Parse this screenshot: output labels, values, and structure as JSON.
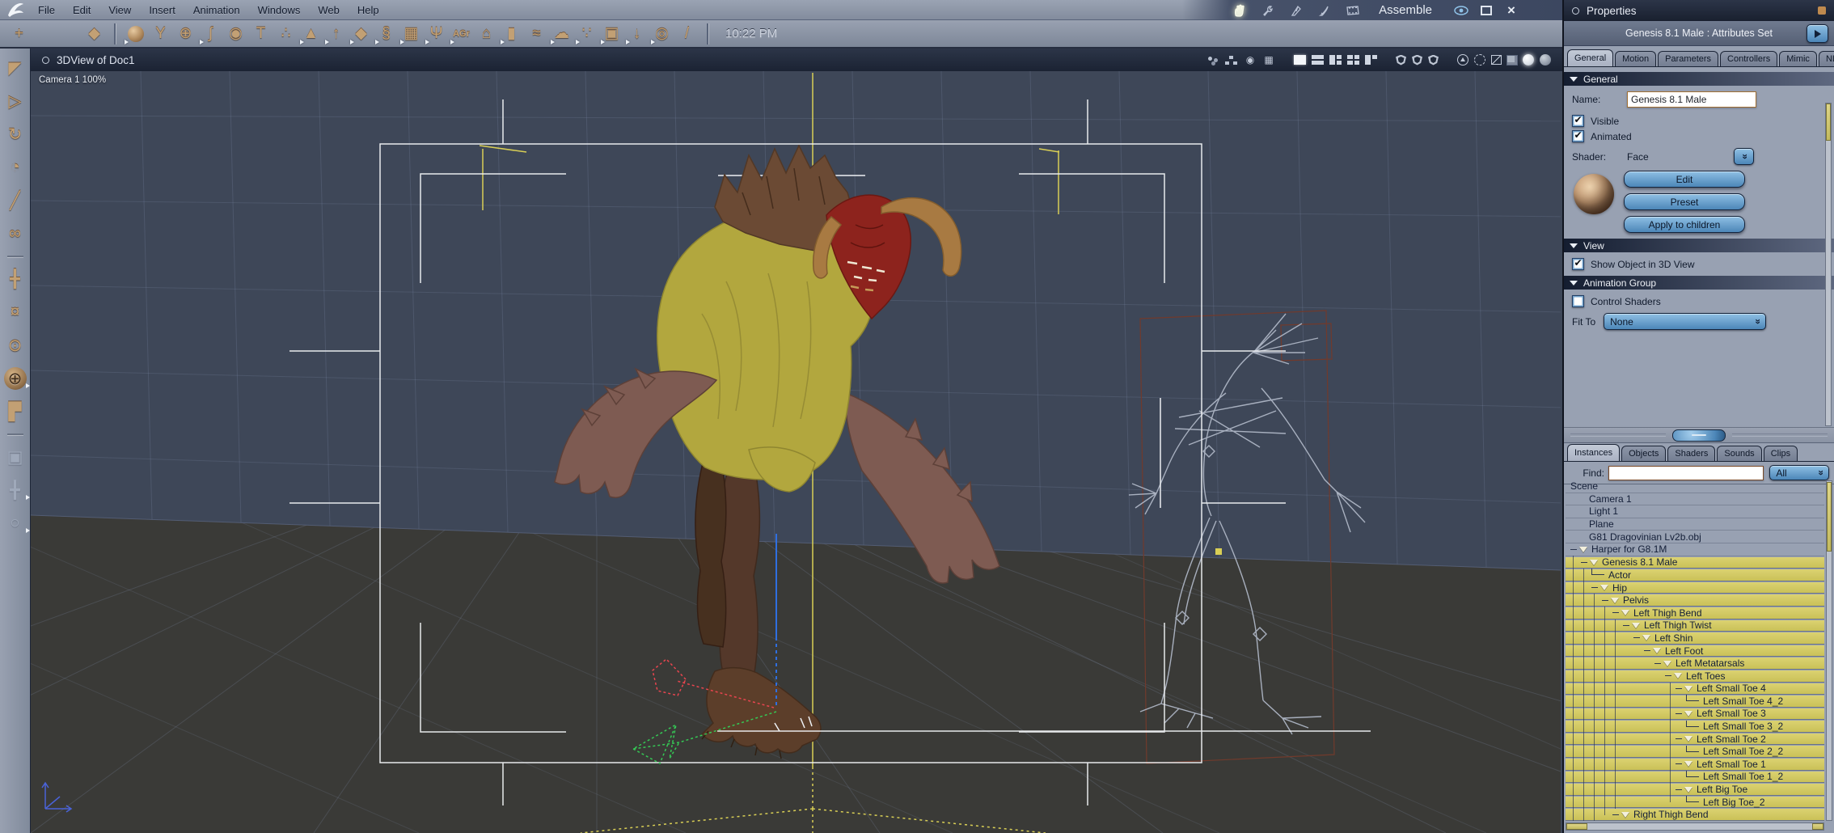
{
  "colors": {
    "accent_blue": "#4c86b8",
    "selection_yellow": "#d3ca62",
    "viewport_bg": "#3e4758",
    "floor": "#3a3a37",
    "panel_bg": "#98a1b2",
    "bar_bg": "#8e96a6",
    "titlebar": "#1b2333"
  },
  "menu": {
    "items": [
      {
        "label": "File"
      },
      {
        "label": "Edit"
      },
      {
        "label": "View"
      },
      {
        "label": "Insert"
      },
      {
        "label": "Animation"
      },
      {
        "label": "Windows"
      },
      {
        "label": "Web"
      },
      {
        "label": "Help"
      }
    ]
  },
  "rooms": {
    "current_label": "Assemble"
  },
  "window_controls": {
    "close_glyph": "×"
  },
  "toolbar": {
    "time": "10:22 PM",
    "group1": [
      {
        "icon": "bone-chain-tool-icon",
        "glyph": "+"
      },
      {
        "icon": "hand-tool-icon",
        "glyph": "",
        "dim": true
      },
      {
        "icon": "wrench-tool-icon",
        "glyph": "",
        "dim": true
      },
      {
        "icon": "stamp-tool-icon",
        "glyph": "◆"
      }
    ],
    "group2": [
      {
        "icon": "insert-sphere-icon",
        "type": "ball",
        "glyph": "",
        "marker": true
      },
      {
        "icon": "insert-vertex-object-icon",
        "glyph": "Y"
      },
      {
        "icon": "insert-metaball-icon",
        "glyph": "⊕"
      },
      {
        "icon": "insert-spline-icon",
        "glyph": "∫",
        "marker": true
      },
      {
        "icon": "insert-cone-icon",
        "glyph": "◉"
      },
      {
        "icon": "insert-text-icon",
        "glyph": "T"
      },
      {
        "icon": "insert-particles-icon",
        "glyph": "∴"
      },
      {
        "icon": "insert-terrain-icon",
        "glyph": "▲",
        "marker": true
      },
      {
        "icon": "insert-tree-icon",
        "glyph": "↑",
        "marker": true
      },
      {
        "icon": "insert-rock-icon",
        "glyph": "◆",
        "marker": true
      },
      {
        "icon": "insert-fire-icon",
        "glyph": "§",
        "marker": true
      },
      {
        "icon": "insert-terrain-checker-icon",
        "glyph": "▦",
        "marker": true
      },
      {
        "icon": "insert-fountain-icon",
        "glyph": "Ψ",
        "marker": true
      },
      {
        "icon": "insert-autogroup-icon",
        "type": "label",
        "glyph": "AGr",
        "marker": true
      },
      {
        "icon": "insert-house-icon",
        "glyph": "⌂"
      },
      {
        "icon": "insert-capsule-icon",
        "glyph": "▮",
        "marker": true
      },
      {
        "icon": "insert-ocean-icon",
        "glyph": "≈"
      },
      {
        "icon": "insert-cloud-icon",
        "glyph": "☁",
        "marker": true
      },
      {
        "icon": "insert-spray-icon",
        "glyph": "∵",
        "marker": true
      },
      {
        "icon": "insert-camera-icon",
        "glyph": "▣",
        "marker": true
      },
      {
        "icon": "insert-light-icon",
        "glyph": "↓",
        "marker": true
      },
      {
        "icon": "insert-target-icon",
        "glyph": "◎",
        "marker": true
      },
      {
        "icon": "insert-bone-icon",
        "glyph": "/"
      }
    ]
  },
  "left_toolbar": {
    "tools": [
      {
        "icon": "select-tool-icon",
        "glyph": "◤"
      },
      {
        "icon": "move-tool-icon",
        "glyph": "▷"
      },
      {
        "icon": "rotate-tool-icon",
        "glyph": "↻"
      },
      {
        "icon": "scale-tool-icon",
        "glyph": "◔"
      },
      {
        "icon": "eyedropper-tool-icon",
        "glyph": "╱"
      },
      {
        "icon": "link-tool-icon",
        "glyph": "∞"
      },
      {
        "sep": true
      },
      {
        "icon": "pan-camera-icon",
        "glyph": "╋"
      },
      {
        "icon": "dolly-camera-icon",
        "glyph": "¤"
      },
      {
        "icon": "orbit-camera-icon",
        "glyph": "⊙"
      },
      {
        "icon": "trackball-camera-icon",
        "glyph": "⊕",
        "active": true,
        "marker": true
      },
      {
        "icon": "corner-view-icon",
        "glyph": "▛"
      },
      {
        "sep": true
      },
      {
        "icon": "render-camera-icon",
        "glyph": "▣",
        "dim": true
      },
      {
        "icon": "pan-2d-icon",
        "glyph": "╋",
        "dim": true,
        "marker": true
      },
      {
        "icon": "zoom-tool-icon",
        "glyph": "○",
        "dim": true,
        "marker": true
      }
    ]
  },
  "viewport": {
    "tab_title": "3DView of Doc1",
    "camera_label": "Camera 1 100%",
    "icons": [
      {
        "icon": "spheres-cluster-icon",
        "type": "dots"
      },
      {
        "icon": "hierarchy-icon",
        "type": "hier"
      },
      {
        "icon": "camera-hud-icon",
        "glyph": "◉"
      },
      {
        "icon": "atom-grid-icon",
        "glyph": "▦"
      },
      {
        "sep": true
      },
      {
        "icon": "layout-single-icon",
        "type": "l1",
        "active": true
      },
      {
        "icon": "layout-rows-icon",
        "type": "l2"
      },
      {
        "icon": "layout-split3-icon",
        "type": "l3"
      },
      {
        "icon": "layout-quad-icon",
        "type": "l4"
      },
      {
        "icon": "layout-corner-icon",
        "type": "l5"
      },
      {
        "sep": true
      },
      {
        "icon": "shield-grid-icon",
        "type": "shield"
      },
      {
        "icon": "shield-person-icon",
        "type": "shield"
      },
      {
        "icon": "shield-globe-icon",
        "type": "shield"
      },
      {
        "sep": true
      },
      {
        "icon": "circle-up-icon",
        "type": "cirup"
      },
      {
        "icon": "sphere-dotted-icon",
        "type": "sphdot"
      },
      {
        "icon": "cube-wire-icon",
        "type": "cubew"
      },
      {
        "icon": "cube-solid-icon",
        "type": "cubes"
      },
      {
        "icon": "sphere-white-icon",
        "type": "sphw",
        "active": true
      },
      {
        "icon": "sphere-textured-icon",
        "type": "spht"
      }
    ]
  },
  "properties": {
    "title": "Properties",
    "subtitle": "Genesis 8.1 Male : Attributes Set",
    "tabs": [
      {
        "label": "General",
        "active": true
      },
      {
        "label": "Motion"
      },
      {
        "label": "Parameters"
      },
      {
        "label": "Controllers"
      },
      {
        "label": "Mimic"
      },
      {
        "label": "NLA"
      }
    ],
    "general": {
      "section": "General",
      "name_label": "Name:",
      "name_value": "Genesis 8.1 Male",
      "visible_label": "Visible",
      "visible_checked": true,
      "animated_label": "Animated",
      "animated_checked": true,
      "shader_label": "Shader:",
      "shader_value": "Face",
      "buttons": [
        {
          "label": "Edit"
        },
        {
          "label": "Preset"
        },
        {
          "label": "Apply to children"
        }
      ]
    },
    "view": {
      "section": "View",
      "show_object_label": "Show Object in 3D View",
      "show_object_checked": true
    },
    "animation_group": {
      "section": "Animation Group",
      "control_shaders_label": "Control Shaders",
      "control_shaders_checked": false,
      "fit_to_label": "Fit To",
      "fit_to_value": "None"
    }
  },
  "browser": {
    "tabs": [
      {
        "label": "Instances",
        "active": true
      },
      {
        "label": "Objects"
      },
      {
        "label": "Shaders"
      },
      {
        "label": "Sounds"
      },
      {
        "label": "Clips"
      }
    ],
    "find_label": "Find:",
    "find_value": "",
    "filter_value": "All",
    "tree": [
      {
        "label": "Scene",
        "type": "header",
        "indent": 0
      },
      {
        "label": "Camera 1",
        "type": "plain",
        "indent": 1
      },
      {
        "label": "Light 1",
        "type": "plain",
        "indent": 1
      },
      {
        "label": "Plane",
        "type": "plain",
        "indent": 1
      },
      {
        "label": "G81 Dragovinian Lv2b.obj",
        "type": "plain",
        "indent": 1
      },
      {
        "label": "Harper for G8.1M",
        "type": "branch",
        "indent": 0
      },
      {
        "label": "Genesis 8.1 Male",
        "type": "branch",
        "indent": 1,
        "selected": true
      },
      {
        "label": "Actor",
        "type": "leaf",
        "indent": 2,
        "selected": true
      },
      {
        "label": "Hip",
        "type": "branch",
        "indent": 2,
        "selected": true
      },
      {
        "label": "Pelvis",
        "type": "branch",
        "indent": 3,
        "selected": true
      },
      {
        "label": "Left Thigh Bend",
        "type": "branch",
        "indent": 4,
        "selected": true
      },
      {
        "label": "Left Thigh Twist",
        "type": "branch",
        "indent": 5,
        "selected": true
      },
      {
        "label": "Left Shin",
        "type": "branch",
        "indent": 6,
        "selected": true
      },
      {
        "label": "Left Foot",
        "type": "branch",
        "indent": 7,
        "selected": true
      },
      {
        "label": "Left Metatarsals",
        "type": "branch",
        "indent": 8,
        "selected": true
      },
      {
        "label": "Left Toes",
        "type": "branch",
        "indent": 9,
        "selected": true
      },
      {
        "label": "Left Small Toe 4",
        "type": "branch",
        "indent": 10,
        "selected": true
      },
      {
        "label": "Left Small Toe 4_2",
        "type": "leaf",
        "indent": 11,
        "selected": true
      },
      {
        "label": "Left Small Toe 3",
        "type": "branch",
        "indent": 10,
        "selected": true
      },
      {
        "label": "Left Small Toe 3_2",
        "type": "leaf",
        "indent": 11,
        "selected": true
      },
      {
        "label": "Left Small Toe 2",
        "type": "branch",
        "indent": 10,
        "selected": true
      },
      {
        "label": "Left Small Toe 2_2",
        "type": "leaf",
        "indent": 11,
        "selected": true
      },
      {
        "label": "Left Small Toe 1",
        "type": "branch",
        "indent": 10,
        "selected": true
      },
      {
        "label": "Left Small Toe 1_2",
        "type": "leaf",
        "indent": 11,
        "selected": true
      },
      {
        "label": "Left Big Toe",
        "type": "branch",
        "indent": 10,
        "selected": true
      },
      {
        "label": "Left Big Toe_2",
        "type": "leaf",
        "indent": 11,
        "selected": true
      },
      {
        "label": "Right Thigh Bend",
        "type": "branch",
        "indent": 4,
        "selected": true
      }
    ]
  }
}
